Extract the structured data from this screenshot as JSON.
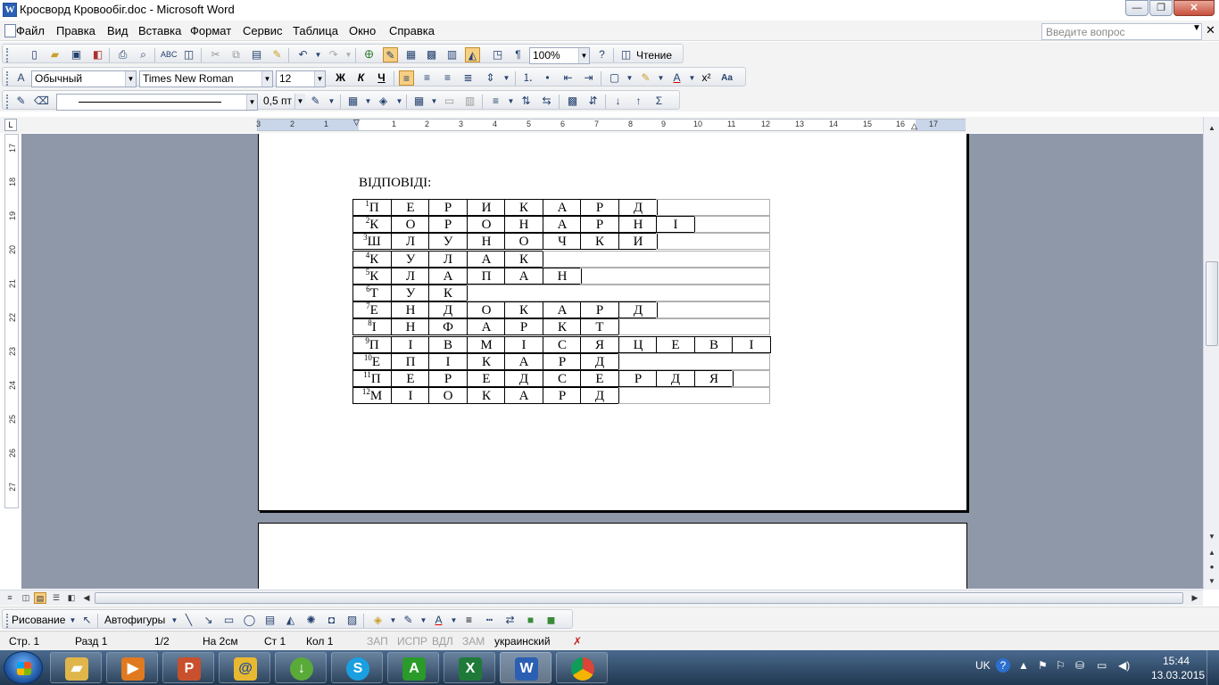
{
  "window": {
    "title": "Кросворд Кровообіг.doc - Microsoft Word",
    "min_glyph": "—",
    "max_glyph": "❐",
    "close_glyph": "✕",
    "doc_close_glyph": "✕"
  },
  "menu": {
    "items": [
      "Файл",
      "Правка",
      "Вид",
      "Вставка",
      "Формат",
      "Сервис",
      "Таблица",
      "Окно",
      "Справка"
    ],
    "help_placeholder": "Введите вопрос"
  },
  "toolbar_standard": {
    "zoom": "100%",
    "reading_label": "Чтение"
  },
  "toolbar_formatting": {
    "style": "Обычный",
    "font": "Times New Roman",
    "size": "12",
    "bold": "Ж",
    "italic": "К",
    "underline": "Ч",
    "superscript": "x²"
  },
  "toolbar_tables": {
    "line_weight": "0,5 пт"
  },
  "ruler": {
    "corner": "L",
    "h_ticks": [
      "3",
      "2",
      "1",
      "1",
      "2",
      "3",
      "4",
      "5",
      "6",
      "7",
      "8",
      "9",
      "10",
      "11",
      "12",
      "13",
      "14",
      "15",
      "16",
      "17"
    ],
    "v_ticks": [
      "17",
      "18",
      "19",
      "20",
      "21",
      "22",
      "23",
      "24",
      "25",
      "26",
      "27"
    ]
  },
  "document": {
    "heading": "ВІДПОВІДІ:",
    "rows": [
      {
        "num": "1",
        "letters": [
          "П",
          "Е",
          "Р",
          "И",
          "К",
          "А",
          "Р",
          "Д"
        ]
      },
      {
        "num": "2",
        "letters": [
          "К",
          "О",
          "Р",
          "О",
          "Н",
          "А",
          "Р",
          "Н",
          "І"
        ]
      },
      {
        "num": "3",
        "letters": [
          "Ш",
          "Л",
          "У",
          "Н",
          "О",
          "Ч",
          "К",
          "И"
        ]
      },
      {
        "num": "4",
        "letters": [
          "К",
          "У",
          "Л",
          "А",
          "К"
        ]
      },
      {
        "num": "5",
        "letters": [
          "К",
          "Л",
          "А",
          "П",
          "А",
          "Н"
        ]
      },
      {
        "num": "6",
        "letters": [
          "Т",
          "У",
          "К"
        ]
      },
      {
        "num": "7",
        "letters": [
          "Е",
          "Н",
          "Д",
          "О",
          "К",
          "А",
          "Р",
          "Д"
        ]
      },
      {
        "num": "8",
        "letters": [
          "І",
          "Н",
          "Ф",
          "А",
          "Р",
          "К",
          "Т"
        ]
      },
      {
        "num": "9",
        "letters": [
          "П",
          "І",
          "В",
          "М",
          "І",
          "С",
          "Я",
          "Ц",
          "Е",
          "В",
          "І"
        ]
      },
      {
        "num": "10",
        "letters": [
          "Е",
          "П",
          "І",
          "К",
          "А",
          "Р",
          "Д"
        ]
      },
      {
        "num": "11",
        "letters": [
          "П",
          "Е",
          "Р",
          "Е",
          "Д",
          "С",
          "Е",
          "Р",
          "Д",
          "Я"
        ]
      },
      {
        "num": "12",
        "letters": [
          "М",
          "І",
          "О",
          "К",
          "А",
          "Р",
          "Д"
        ]
      }
    ]
  },
  "drawing_toolbar": {
    "draw_label": "Рисование",
    "autoshapes_label": "Автофигуры"
  },
  "status": {
    "page": "Стр. 1",
    "section": "Разд 1",
    "pages": "1/2",
    "at": "На 2см",
    "line": "Ст 1",
    "col": "Кол 1",
    "rec": "ЗАП",
    "trk": "ИСПР",
    "ext": "ВДЛ",
    "ovr": "ЗАМ",
    "language": "украинский"
  },
  "taskbar": {
    "lang": "UK",
    "time": "15:44",
    "date": "13.03.2015"
  }
}
